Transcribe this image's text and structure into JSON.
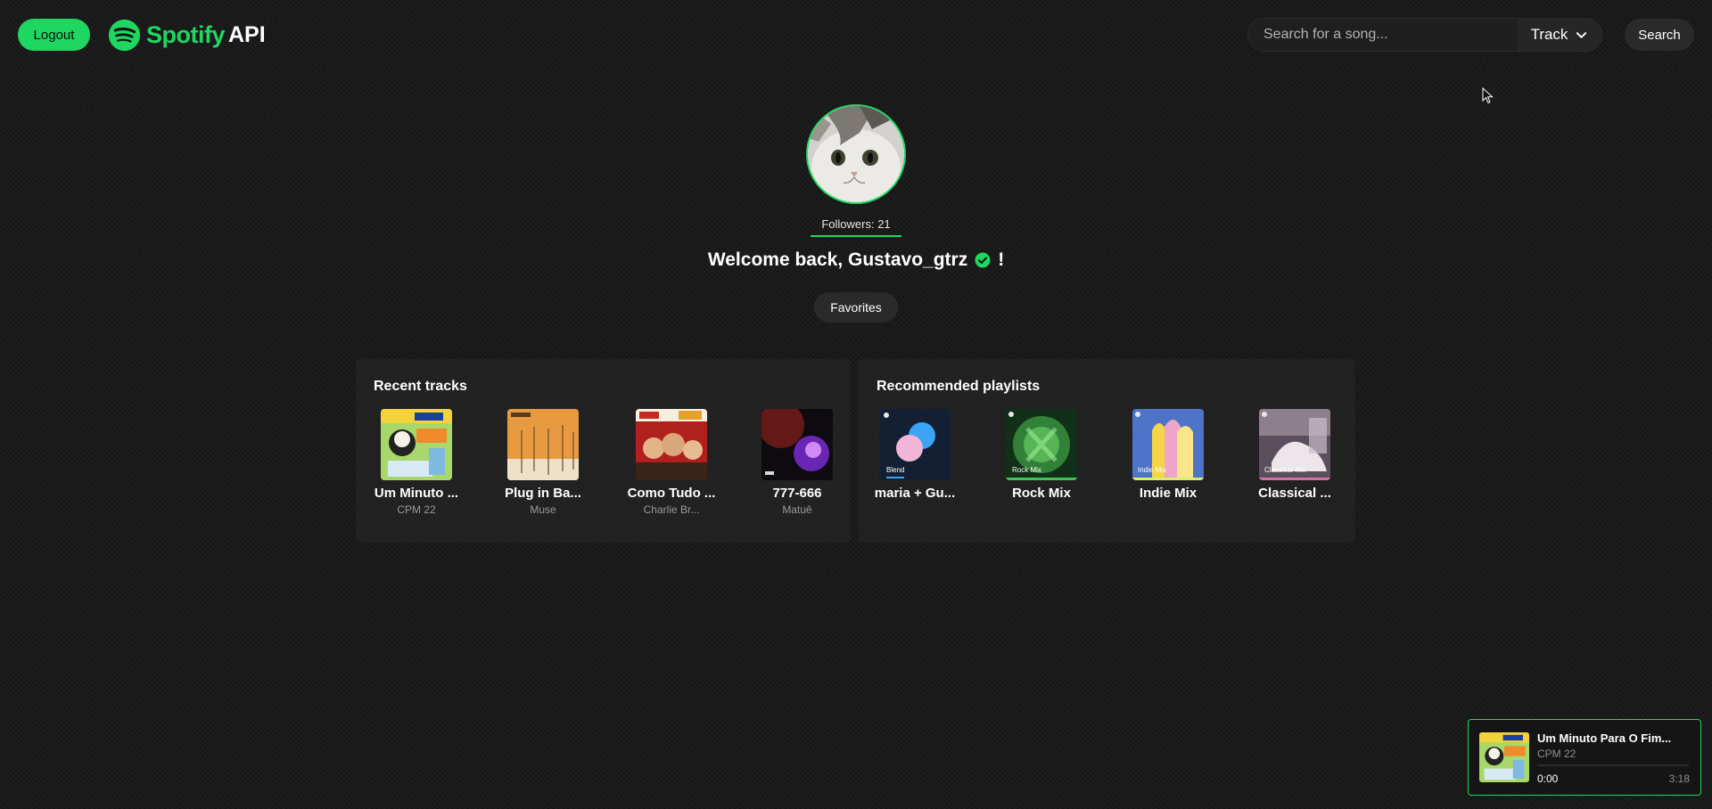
{
  "header": {
    "logout_label": "Logout",
    "brand_name": "Spotify",
    "brand_suffix": "API",
    "search_placeholder": "Search for a song...",
    "search_type": "Track",
    "search_button": "Search"
  },
  "profile": {
    "followers": "Followers: 21",
    "welcome_prefix": "Welcome back, Gustavo_gtrz",
    "welcome_suffix": "!",
    "favorites_label": "Favorites"
  },
  "recent_tracks": {
    "title": "Recent tracks",
    "items": [
      {
        "title": "Um Minuto ...",
        "artist": "CPM 22"
      },
      {
        "title": "Plug in Ba...",
        "artist": "Muse"
      },
      {
        "title": "Como Tudo ...",
        "artist": "Charlie Br..."
      },
      {
        "title": "777-666",
        "artist": "Matuê"
      }
    ]
  },
  "recommended_playlists": {
    "title": "Recommended playlists",
    "items": [
      {
        "title": "maria + Gu...",
        "cover_label": "Blend"
      },
      {
        "title": "Rock Mix",
        "cover_label": "Rock Mix"
      },
      {
        "title": "Indie Mix",
        "cover_label": "Indie Mix"
      },
      {
        "title": "Classical ...",
        "cover_label": "Classical Mix"
      }
    ]
  },
  "player": {
    "title": "Um Minuto Para O Fim...",
    "artist": "CPM 22",
    "current_time": "0:00",
    "duration": "3:18",
    "progress": 0
  },
  "colors": {
    "accent": "#1ed760",
    "background": "#161616"
  }
}
